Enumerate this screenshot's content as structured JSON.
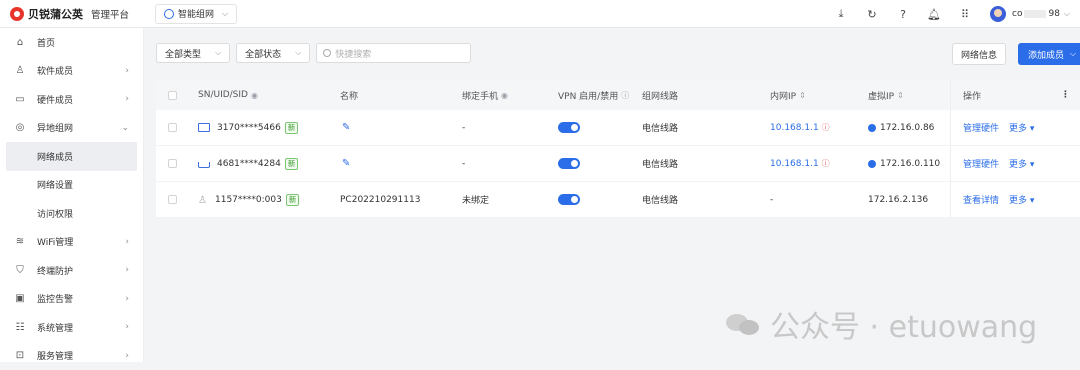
{
  "header": {
    "brand": "贝锐蒲公英",
    "platform": "管理平台",
    "app_switch": "智能组网",
    "username_prefix": "co",
    "username_suffix": "98"
  },
  "sidebar": {
    "items": [
      {
        "label": "首页",
        "icon": "home-icon"
      },
      {
        "label": "软件成员",
        "icon": "user-icon"
      },
      {
        "label": "硬件成员",
        "icon": "hardware-icon"
      },
      {
        "label": "异地组网",
        "icon": "network-icon"
      },
      {
        "label": "网络成员"
      },
      {
        "label": "网络设置"
      },
      {
        "label": "访问权限"
      },
      {
        "label": "WiFi管理",
        "icon": "wifi-icon"
      },
      {
        "label": "终端防护",
        "icon": "shield-icon"
      },
      {
        "label": "监控告警",
        "icon": "monitor-icon"
      },
      {
        "label": "系统管理",
        "icon": "settings-icon"
      },
      {
        "label": "服务管理",
        "icon": "service-icon"
      }
    ]
  },
  "filters": {
    "type": "全部类型",
    "status": "全部状态",
    "search_placeholder": "快捷搜索"
  },
  "actions": {
    "network_info": "网络信息",
    "add_member": "添加成员"
  },
  "table": {
    "headers": {
      "id": "SN/UID/SID",
      "name": "名称",
      "phone": "绑定手机",
      "vpn": "VPN 启用/禁用",
      "route": "组网线路",
      "lan_ip": "内网IP",
      "virtual_ip": "虚拟IP",
      "ops": "操作"
    },
    "rows": [
      {
        "id": "3170****5466",
        "tag": "新",
        "name": "",
        "phone": "-",
        "route": "电信线路",
        "lan_ip": "10.168.1.1",
        "virtual_ip": "172.16.0.86",
        "op": "管理硬件",
        "more": "更多"
      },
      {
        "id": "4681****4284",
        "tag": "新",
        "name": "",
        "phone": "-",
        "route": "电信线路",
        "lan_ip": "10.168.1.1",
        "virtual_ip": "172.16.0.110",
        "op": "管理硬件",
        "more": "更多"
      },
      {
        "id": "1157****0:003",
        "tag": "新",
        "name": "PC202210291113",
        "phone": "未绑定",
        "route": "电信线路",
        "lan_ip": "-",
        "virtual_ip": "172.16.2.136",
        "op": "查看详情",
        "more": "更多"
      }
    ]
  },
  "watermark": "公众号 · etuowang",
  "colors": {
    "primary": "#2b6de8",
    "brand_red": "#e8352b",
    "tag_green": "#3a9a2c"
  }
}
